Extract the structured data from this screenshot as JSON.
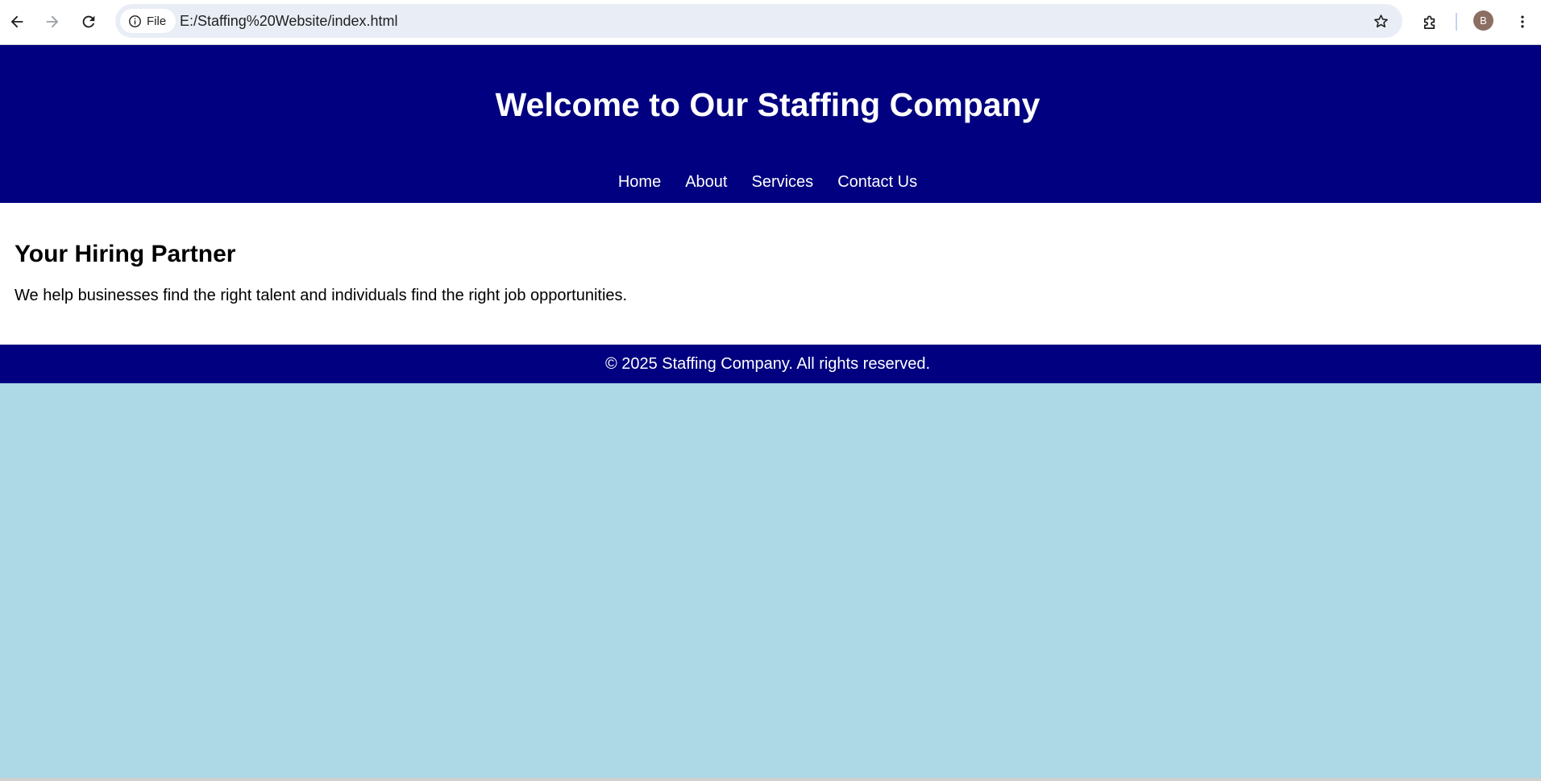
{
  "browser": {
    "site_info_label": "File",
    "url": "E:/Staffing%20Website/index.html",
    "profile_initial": "B",
    "icons": {
      "back": "arrow-left-icon",
      "forward": "arrow-right-icon",
      "reload": "reload-icon",
      "site_info": "info-circle-icon",
      "bookmark": "star-outline-icon",
      "extensions": "puzzle-piece-icon",
      "menu": "vertical-dots-icon"
    }
  },
  "page": {
    "header": {
      "title": "Welcome to Our Staffing Company",
      "nav": [
        {
          "label": "Home"
        },
        {
          "label": "About"
        },
        {
          "label": "Services"
        },
        {
          "label": "Contact Us"
        }
      ]
    },
    "main": {
      "heading": "Your Hiring Partner",
      "body": "We help businesses find the right talent and individuals find the right job opportunities."
    },
    "footer": {
      "text": "© 2025 Staffing Company. All rights reserved."
    }
  },
  "colors": {
    "header_bg": "#000080",
    "footer_bg": "#000080",
    "page_bg": "#add8e6",
    "main_bg": "#ffffff",
    "avatar_bg": "#8d6e63"
  }
}
